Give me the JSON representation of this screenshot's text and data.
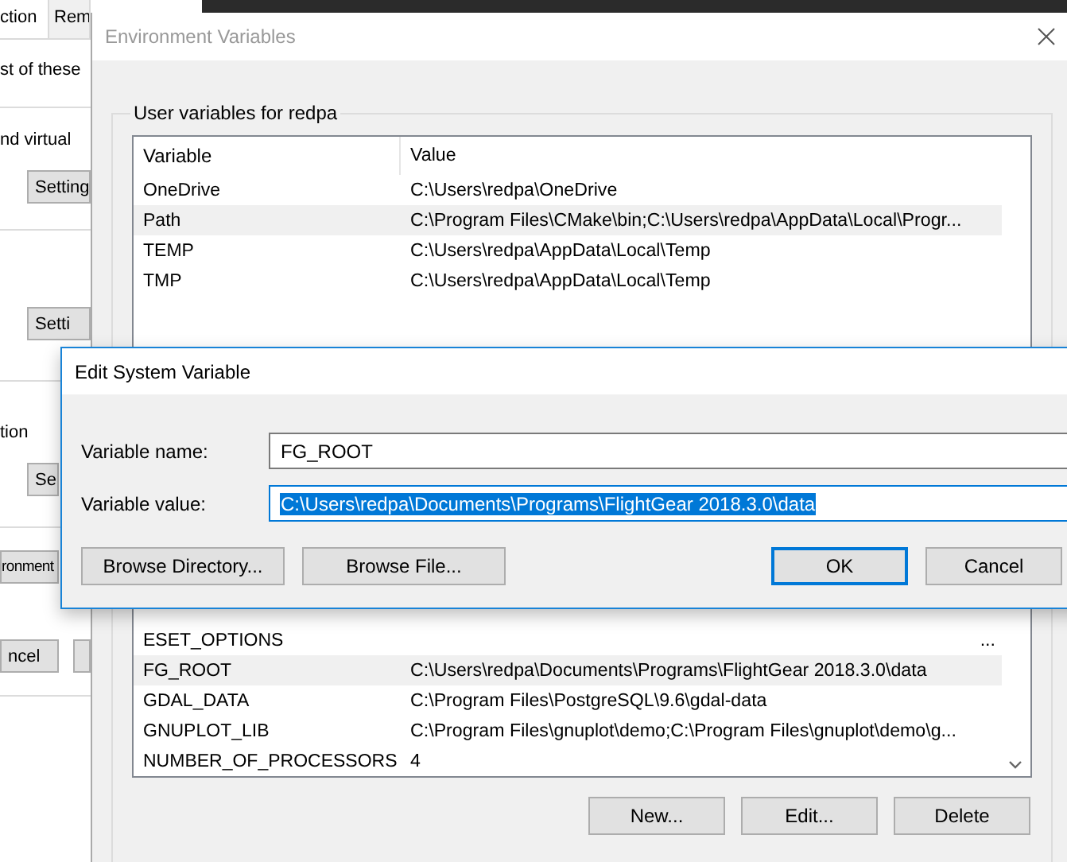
{
  "back_window": {
    "tabs": [
      {
        "label": "ction",
        "selected": true
      },
      {
        "label": "Rem",
        "selected": false
      }
    ],
    "sections": [
      [
        {
          "kind": "text",
          "text": "st of these"
        }
      ],
      [
        {
          "kind": "text",
          "text": "nd virtual"
        },
        {
          "kind": "button",
          "label": "Setting"
        }
      ],
      [
        {
          "kind": "button",
          "label": "Setti"
        }
      ],
      [
        {
          "kind": "text",
          "text": "tion"
        },
        {
          "kind": "button",
          "label": "Se"
        }
      ],
      [
        {
          "kind": "button",
          "label": "ronment"
        }
      ]
    ],
    "footer_buttons": [
      "ncel"
    ]
  },
  "env_window": {
    "title": "Environment Variables",
    "active": false,
    "user_variables": {
      "title": "User variables for redpa",
      "columns": [
        "Variable",
        "Value"
      ],
      "rows": [
        {
          "variable": "OneDrive",
          "value": "C:\\Users\\redpa\\OneDrive",
          "selected": false
        },
        {
          "variable": "Path",
          "value": "C:\\Program Files\\CMake\\bin;C:\\Users\\redpa\\AppData\\Local\\Progr...",
          "selected": true
        },
        {
          "variable": "TEMP",
          "value": "C:\\Users\\redpa\\AppData\\Local\\Temp",
          "selected": false
        },
        {
          "variable": "TMP",
          "value": "C:\\Users\\redpa\\AppData\\Local\\Temp",
          "selected": false
        }
      ]
    },
    "system_variables": {
      "rows": [
        {
          "variable": "ESET_OPTIONS",
          "value": "...",
          "selected": false
        },
        {
          "variable": "FG_ROOT",
          "value": "C:\\Users\\redpa\\Documents\\Programs\\FlightGear 2018.3.0\\data",
          "selected": true
        },
        {
          "variable": "GDAL_DATA",
          "value": "C:\\Program Files\\PostgreSQL\\9.6\\gdal-data",
          "selected": false
        },
        {
          "variable": "GNUPLOT_LIB",
          "value": "C:\\Program Files\\gnuplot\\demo;C:\\Program Files\\gnuplot\\demo\\g...",
          "selected": false
        },
        {
          "variable": "NUMBER_OF_PROCESSORS",
          "value": "4",
          "selected": false
        }
      ],
      "buttons": [
        "New...",
        "Edit...",
        "Delete"
      ]
    }
  },
  "edit_dialog": {
    "title": "Edit System Variable",
    "fields": [
      {
        "label": "Variable name:",
        "value": "FG_ROOT",
        "focused": false,
        "text_selected": false
      },
      {
        "label": "Variable value:",
        "value": "C:\\Users\\redpa\\Documents\\Programs\\FlightGear 2018.3.0\\data",
        "focused": true,
        "text_selected": true
      }
    ],
    "browse_buttons": [
      "Browse Directory...",
      "Browse File..."
    ],
    "buttons": [
      {
        "label": "OK",
        "default": true
      },
      {
        "label": "Cancel",
        "default": false
      }
    ]
  }
}
